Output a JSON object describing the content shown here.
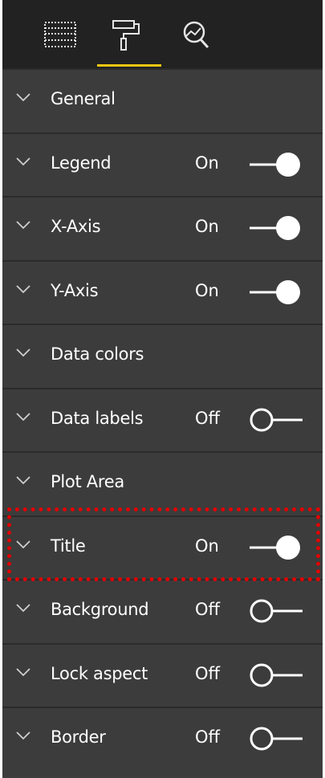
{
  "tabs": [
    {
      "name": "fields-icon"
    },
    {
      "name": "format-paint-roller-icon",
      "active": true
    },
    {
      "name": "analytics-magnifier-icon"
    }
  ],
  "colors": {
    "accent": "#f2c811",
    "panel": "#3c3c3c",
    "topbar": "#222222",
    "highlight": "#e30000"
  },
  "sections": [
    {
      "label": "General",
      "state": "",
      "toggle": null
    },
    {
      "label": "Legend",
      "state": "On",
      "toggle": true
    },
    {
      "label": "X-Axis",
      "state": "On",
      "toggle": true
    },
    {
      "label": "Y-Axis",
      "state": "On",
      "toggle": true
    },
    {
      "label": "Data colors",
      "state": "",
      "toggle": null
    },
    {
      "label": "Data labels",
      "state": "Off",
      "toggle": false
    },
    {
      "label": "Plot Area",
      "state": "",
      "toggle": null
    },
    {
      "label": "Title",
      "state": "On",
      "toggle": true
    },
    {
      "label": "Background",
      "state": "Off",
      "toggle": false
    },
    {
      "label": "Lock aspect",
      "state": "Off",
      "toggle": false
    },
    {
      "label": "Border",
      "state": "Off",
      "toggle": false
    }
  ]
}
